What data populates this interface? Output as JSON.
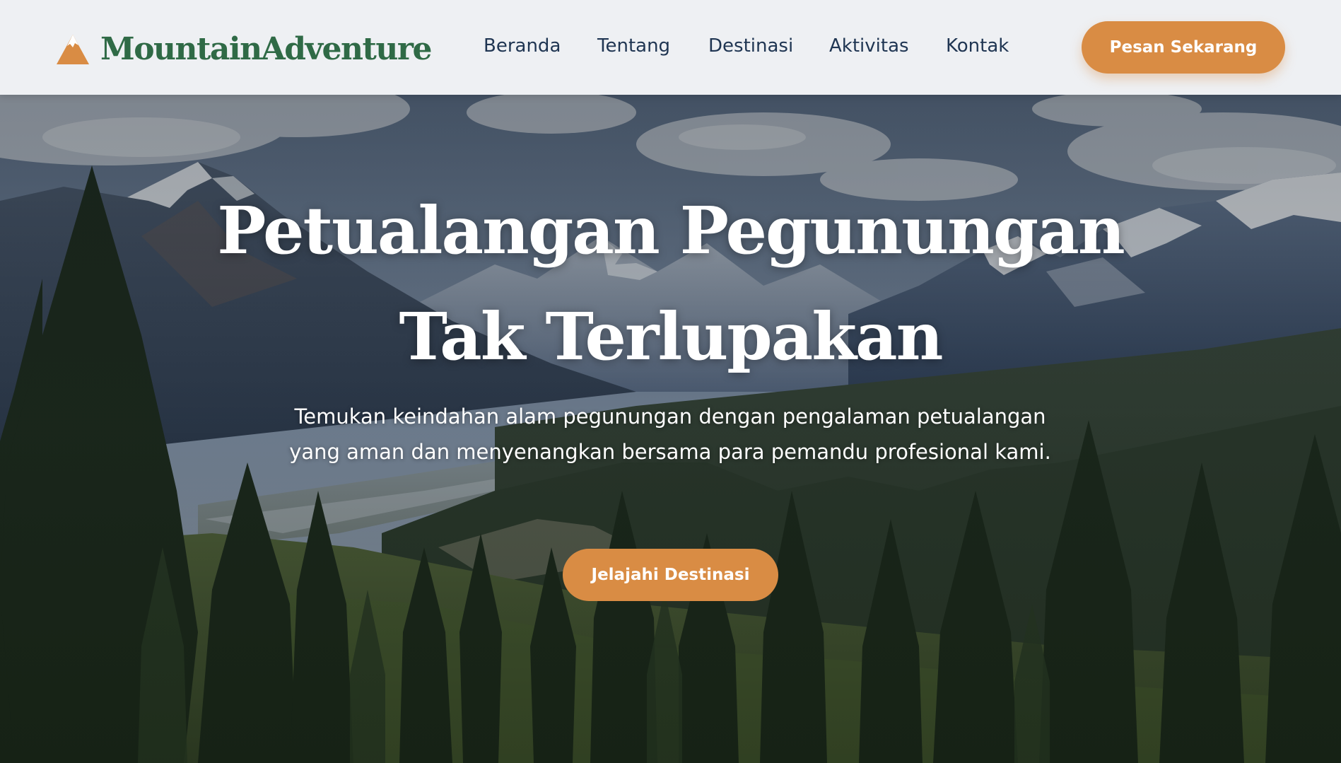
{
  "brand": {
    "name": "MountainAdventure",
    "icon": "mountain-icon",
    "color": "#2f6a46",
    "icon_color": "#d98c44"
  },
  "nav": {
    "items": [
      {
        "label": "Beranda"
      },
      {
        "label": "Tentang"
      },
      {
        "label": "Destinasi"
      },
      {
        "label": "Aktivitas"
      },
      {
        "label": "Kontak"
      }
    ],
    "color": "#1f3552"
  },
  "header": {
    "cta_label": "Pesan Sekarang"
  },
  "hero": {
    "title_line1": "Petualangan Pegunungan",
    "title_line2": "Tak Terlupakan",
    "subtitle": "Temukan keindahan alam pegunungan dengan pengalaman petualangan yang aman dan menyenangkan bersama para pemandu profesional kami.",
    "cta_label": "Jelajahi Destinasi"
  },
  "colors": {
    "accent": "#d98c44",
    "header_bg": "#eef0f3",
    "text_light": "#ffffff"
  }
}
